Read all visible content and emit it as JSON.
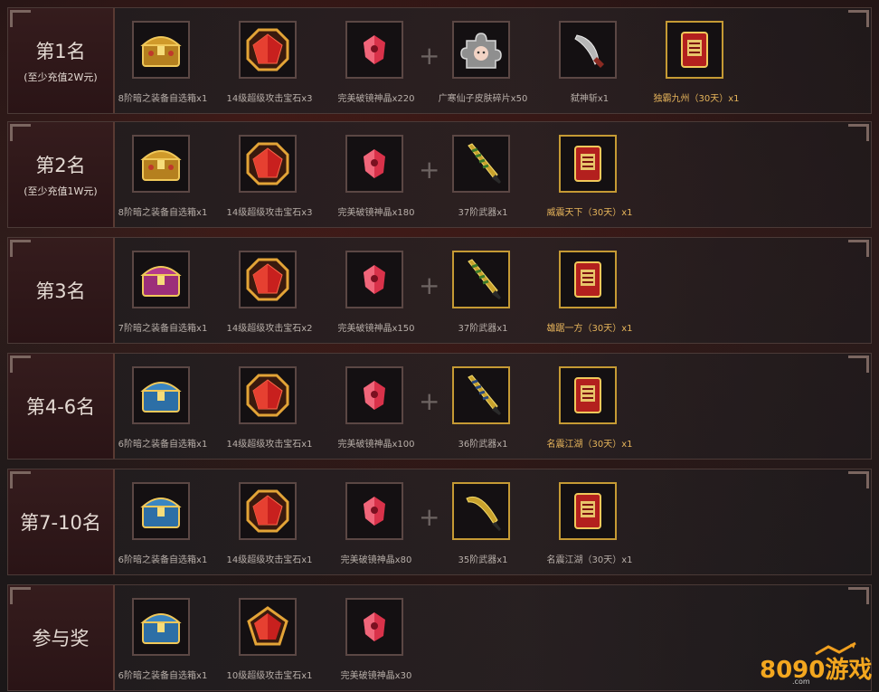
{
  "rows": [
    {
      "rank": "第1名",
      "sub": "(至少充值2W元)",
      "items": [
        {
          "label": "8阶暗之装备自选箱x1",
          "icon": "treasure-chest-icon"
        },
        {
          "label": "14级超级攻击宝石x3",
          "icon": "red-gem-icon"
        },
        {
          "label": "完美破镜神晶x220",
          "icon": "crystal-icon"
        },
        {
          "label": "广寒仙子皮肤碎片x50",
          "icon": "puzzle-piece-icon"
        },
        {
          "label": "弑神斩x1",
          "icon": "blade-icon"
        },
        {
          "label": "独霸九州（30天）x1",
          "icon": "title-scroll-icon"
        }
      ]
    },
    {
      "rank": "第2名",
      "sub": "(至少充值1W元)",
      "items": [
        {
          "label": "8阶暗之装备自选箱x1",
          "icon": "treasure-chest-icon"
        },
        {
          "label": "14级超级攻击宝石x3",
          "icon": "red-gem-icon"
        },
        {
          "label": "完美破镜神晶x180",
          "icon": "crystal-icon"
        },
        {
          "label": "37阶武器x1",
          "icon": "sword-icon"
        },
        {
          "label": "威震天下（30天）x1",
          "icon": "title-scroll-icon"
        }
      ]
    },
    {
      "rank": "第3名",
      "sub": "",
      "items": [
        {
          "label": "7阶暗之装备自选箱x1",
          "icon": "treasure-chest-icon"
        },
        {
          "label": "14级超级攻击宝石x2",
          "icon": "red-gem-icon"
        },
        {
          "label": "完美破镜神晶x150",
          "icon": "crystal-icon"
        },
        {
          "label": "37阶武器x1",
          "icon": "sword-icon"
        },
        {
          "label": "雄踞一方（30天）x1",
          "icon": "title-scroll-icon"
        }
      ]
    },
    {
      "rank": "第4-6名",
      "sub": "",
      "items": [
        {
          "label": "6阶暗之装备自选箱x1",
          "icon": "treasure-chest-icon"
        },
        {
          "label": "14级超级攻击宝石x1",
          "icon": "red-gem-icon"
        },
        {
          "label": "完美破镜神晶x100",
          "icon": "crystal-icon"
        },
        {
          "label": "36阶武器x1",
          "icon": "sword-icon"
        },
        {
          "label": "名震江湖（30天）x1",
          "icon": "title-scroll-icon"
        }
      ]
    },
    {
      "rank": "第7-10名",
      "sub": "",
      "items": [
        {
          "label": "6阶暗之装备自选箱x1",
          "icon": "treasure-chest-icon"
        },
        {
          "label": "14级超级攻击宝石x1",
          "icon": "red-gem-icon"
        },
        {
          "label": "完美破镜神晶x80",
          "icon": "crystal-icon"
        },
        {
          "label": "35阶武器x1",
          "icon": "sword-icon"
        },
        {
          "label": "名震江湖（30天）x1",
          "icon": "title-scroll-icon"
        }
      ]
    },
    {
      "rank": "参与奖",
      "sub": "",
      "items": [
        {
          "label": "6阶暗之装备自选箱x1",
          "icon": "treasure-chest-icon"
        },
        {
          "label": "10级超级攻击宝石x1",
          "icon": "red-gem-icon"
        },
        {
          "label": "完美破镜神晶x30",
          "icon": "crystal-icon"
        }
      ]
    }
  ],
  "plus_sign": "+",
  "logo": {
    "text": "8090游戏",
    "sub": ".com"
  },
  "colors": {
    "accent_gold": "#c59a34",
    "rank_bg": "#351c1d",
    "label_yellow": "#e7b55b"
  }
}
